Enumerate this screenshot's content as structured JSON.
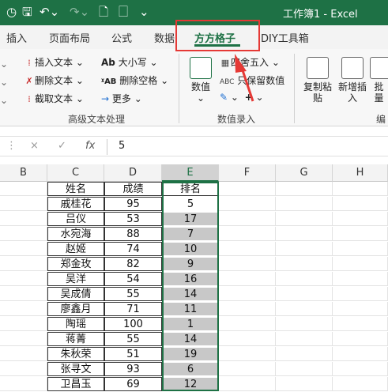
{
  "titlebar": {
    "title": "工作簿1  -  Excel"
  },
  "tabs": [
    "插入",
    "页面布局",
    "公式",
    "数据",
    "方方格子",
    "DIY工具箱"
  ],
  "active_tab": "方方格子",
  "ribbon": {
    "text_group": {
      "items": [
        "插入文本",
        "删除文本",
        "截取文本",
        "大小写",
        "删除空格",
        "更多"
      ],
      "label": "高级文本处理"
    },
    "numeric_group": {
      "value_button": "数值",
      "round_label": "四舍五入",
      "keep_value_label": "只保留数值",
      "label": "数值录入"
    },
    "paste_group": {
      "copy_paste": "复制粘贴",
      "new_insert": "新增插入",
      "batch": "批量",
      "edit_label": "编"
    }
  },
  "formula": {
    "cancel": "×",
    "confirm": "✓",
    "fx": "fx",
    "value": "5"
  },
  "columns": [
    "B",
    "C",
    "D",
    "E",
    "F",
    "G",
    "H"
  ],
  "table": {
    "headers": [
      "姓名",
      "成绩",
      "排名"
    ],
    "rows": [
      [
        "戚桂花",
        "95",
        "5"
      ],
      [
        "吕仪",
        "53",
        "17"
      ],
      [
        "水宛海",
        "88",
        "7"
      ],
      [
        "赵姬",
        "74",
        "10"
      ],
      [
        "郑金玫",
        "82",
        "9"
      ],
      [
        "吴洋",
        "54",
        "16"
      ],
      [
        "吴成倩",
        "55",
        "14"
      ],
      [
        "廖鑫月",
        "71",
        "11"
      ],
      [
        "陶瑶",
        "100",
        "1"
      ],
      [
        "蒋菁",
        "55",
        "14"
      ],
      [
        "朱秋荣",
        "51",
        "19"
      ],
      [
        "张寻文",
        "93",
        "6"
      ],
      [
        "卫昌玉",
        "69",
        "12"
      ]
    ]
  },
  "colors": {
    "excel_green": "#1e7145",
    "highlight_red": "#e53935"
  }
}
